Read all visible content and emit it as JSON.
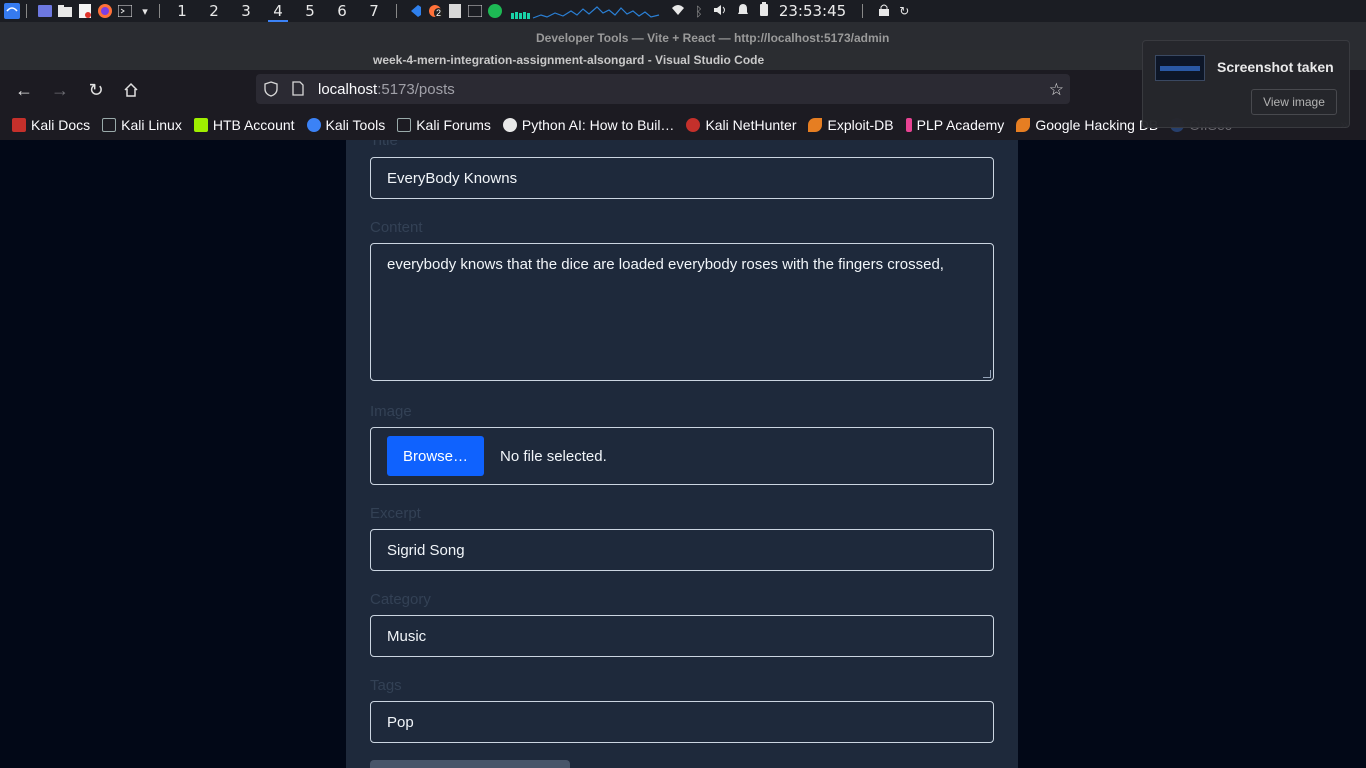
{
  "taskbar": {
    "workspaces": [
      "1",
      "2",
      "3",
      "4",
      "5",
      "6",
      "7"
    ],
    "active_workspace": "4",
    "clock": "23:53:45",
    "badge": "2"
  },
  "background_window": {
    "devtools_title": "Developer Tools — Vite + React — http://localhost:5173/admin",
    "vscode_title": "week-4-mern-integration-assignment-alsongard - Visual Studio Code"
  },
  "browser": {
    "url_host": "localhost",
    "url_path": ":5173/posts"
  },
  "bookmarks": [
    {
      "label": "Kali Docs",
      "color": "#c4302b"
    },
    {
      "label": "Kali Linux",
      "color": "#3b82f6"
    },
    {
      "label": "HTB Account",
      "color": "#9fef00"
    },
    {
      "label": "Kali Tools",
      "color": "#3b82f6"
    },
    {
      "label": "Kali Forums",
      "color": "#3b82f6"
    },
    {
      "label": "Python AI: How to Buil…",
      "color": "#e8e8e8"
    },
    {
      "label": "Kali NetHunter",
      "color": "#c4302b"
    },
    {
      "label": "Exploit-DB",
      "color": "#e67e22"
    },
    {
      "label": "PLP Academy",
      "color": "#e84393"
    },
    {
      "label": "Google Hacking DB",
      "color": "#e67e22"
    },
    {
      "label": "OffSec",
      "color": "#3b82f6"
    }
  ],
  "form": {
    "title_label": "Title",
    "title_value": "EveryBody Knowns",
    "content_label": "Content",
    "content_value": "everybody knows that the dice are loaded everybody roses with the fingers crossed,",
    "image_label": "Image",
    "browse_label": "Browse…",
    "no_file_text": "No file selected.",
    "excerpt_label": "Excerpt",
    "excerpt_value": "Sigrid Song",
    "category_label": "Category",
    "category_value": "Music",
    "tags_label": "Tags",
    "tags_value": "Pop"
  },
  "notification": {
    "title": "Screenshot taken",
    "action": "View image"
  }
}
